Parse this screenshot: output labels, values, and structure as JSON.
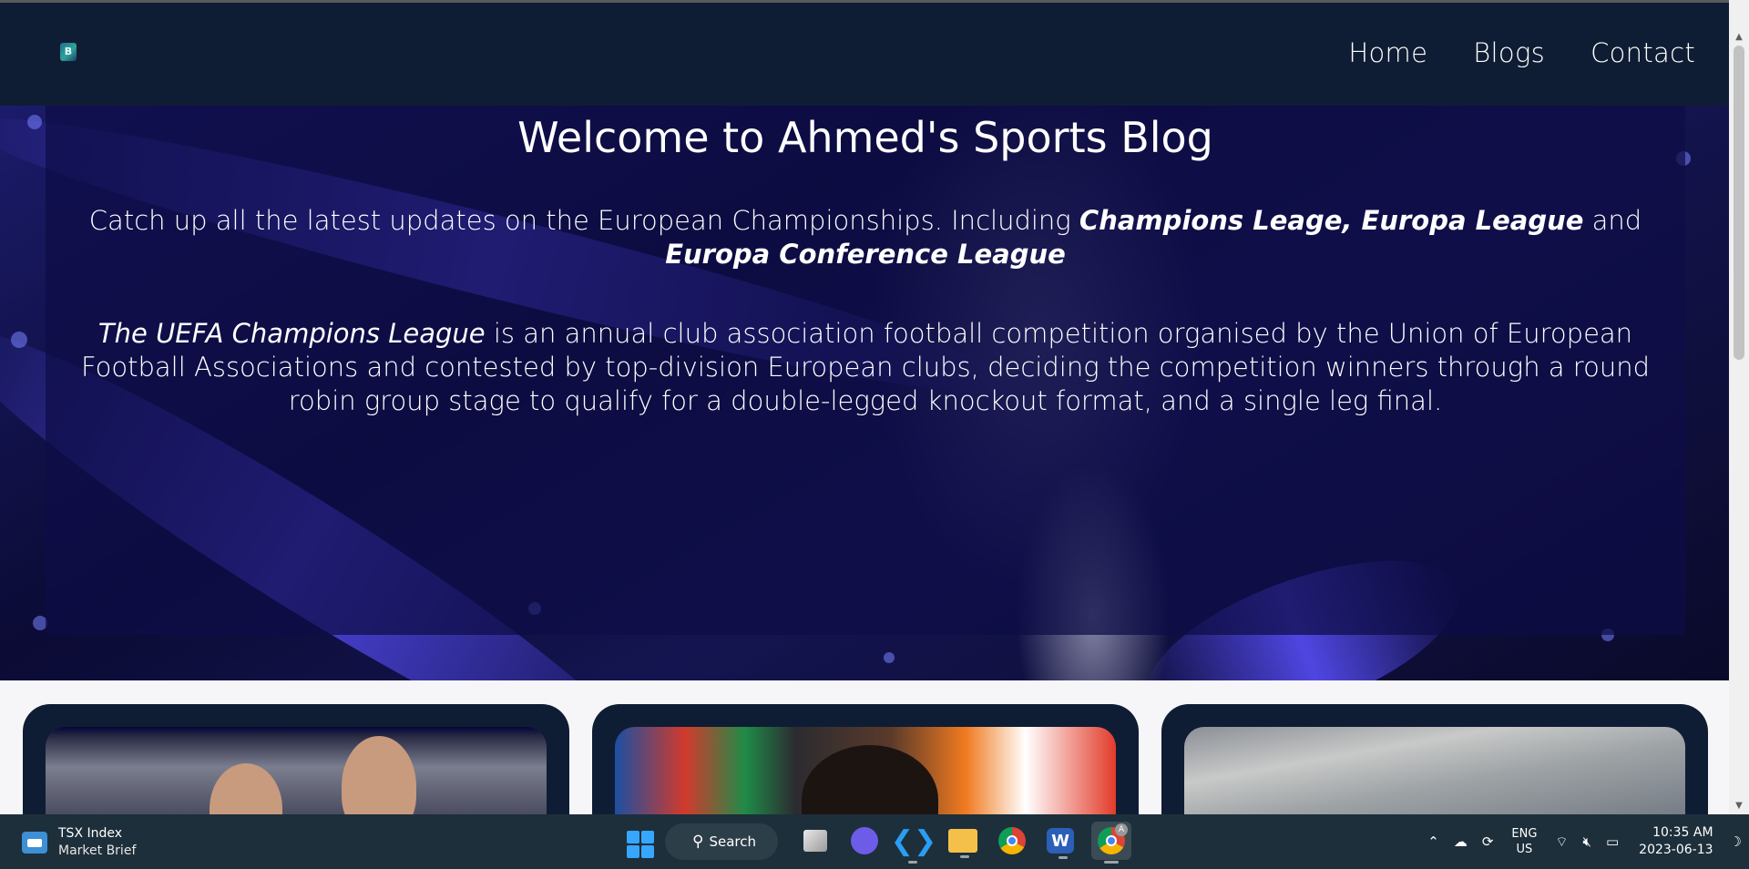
{
  "site": {
    "nav": [
      {
        "label": "Home"
      },
      {
        "label": "Blogs"
      },
      {
        "label": "Contact"
      }
    ],
    "hero": {
      "title": "Welcome to Ahmed's Sports Blog",
      "intro_text": "Catch up all the latest updates on the European Championships. Including",
      "intro_em": "Champions Leage, Europa League",
      "intro_and": "and",
      "intro_em2": "Europa Conference League",
      "desc_em": "The UEFA Champions League",
      "desc_text": "is an annual club association football competition organised by the Union of European Football Associations and contested by top-division European clubs, deciding the competition winners through a round robin group stage to qualify for a double-legged knockout format, and a single leg final."
    },
    "cards": [
      {
        "icon": "players-celebrating-image"
      },
      {
        "icon": "player-press-conference-image"
      },
      {
        "icon": "stadium-aerial-image"
      }
    ]
  },
  "taskbar": {
    "weather_title": "TSX Index",
    "weather_sub": "Market Brief",
    "search_label": "Search",
    "lang_line1": "ENG",
    "lang_line2": "US",
    "time": "10:35 AM",
    "date": "2023-06-13",
    "chrome_badge": "A"
  },
  "colors": {
    "navbar": "#0f1d34",
    "hero_overlay": "#0e0c46",
    "taskbar": "#1d2f3a"
  }
}
